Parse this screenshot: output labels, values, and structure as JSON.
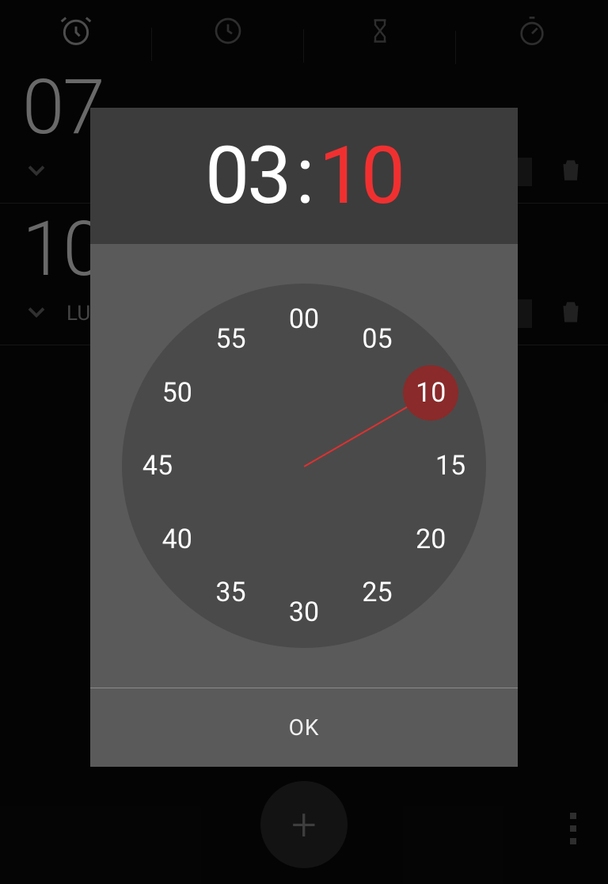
{
  "tabs": {
    "alarm": "alarm",
    "clock": "clock",
    "hourglass": "hourglass",
    "stopwatch": "stopwatch"
  },
  "alarms": [
    {
      "time": "07",
      "day": ""
    },
    {
      "time": "10",
      "day": "LU"
    }
  ],
  "time_picker": {
    "hour": "03",
    "minute": "10",
    "selected_minute": 10,
    "ticks": [
      "00",
      "05",
      "10",
      "15",
      "20",
      "25",
      "30",
      "35",
      "40",
      "45",
      "50",
      "55"
    ],
    "ok_label": "OK"
  },
  "fab": {
    "label": "+"
  }
}
